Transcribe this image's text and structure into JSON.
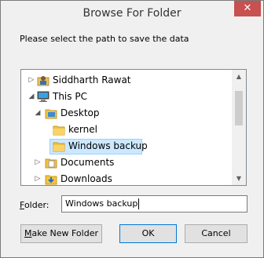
{
  "window": {
    "title": "Browse For Folder",
    "close_glyph": "✕",
    "instruction": "Please select the path to save the data"
  },
  "tree": {
    "items": [
      {
        "label": "Siddharth Rawat",
        "icon": "user-icon",
        "expander": "▷",
        "selected": false
      },
      {
        "label": "This PC",
        "icon": "computer-icon",
        "expander": "◢",
        "selected": false
      },
      {
        "label": "Desktop",
        "icon": "desktop-folder-icon",
        "expander": "◢",
        "selected": false
      },
      {
        "label": "kernel",
        "icon": "folder-icon",
        "expander": "",
        "selected": false
      },
      {
        "label": "Windows backup",
        "icon": "folder-icon",
        "expander": "",
        "selected": true
      },
      {
        "label": "Documents",
        "icon": "documents-folder-icon",
        "expander": "▷",
        "selected": false
      },
      {
        "label": "Downloads",
        "icon": "downloads-folder-icon",
        "expander": "▷",
        "selected": false
      }
    ],
    "scroll_up": "▲",
    "scroll_down": "▼"
  },
  "folder": {
    "label_prefix": "F",
    "label_rest": "older:",
    "value": "Windows backup"
  },
  "buttons": {
    "make_prefix": "M",
    "make_rest": "ake New Folder",
    "ok": "OK",
    "cancel": "Cancel"
  },
  "colors": {
    "selection_bg": "#cce8ff",
    "close_bg": "#c75050",
    "folder_yellow": "#f5c342"
  }
}
